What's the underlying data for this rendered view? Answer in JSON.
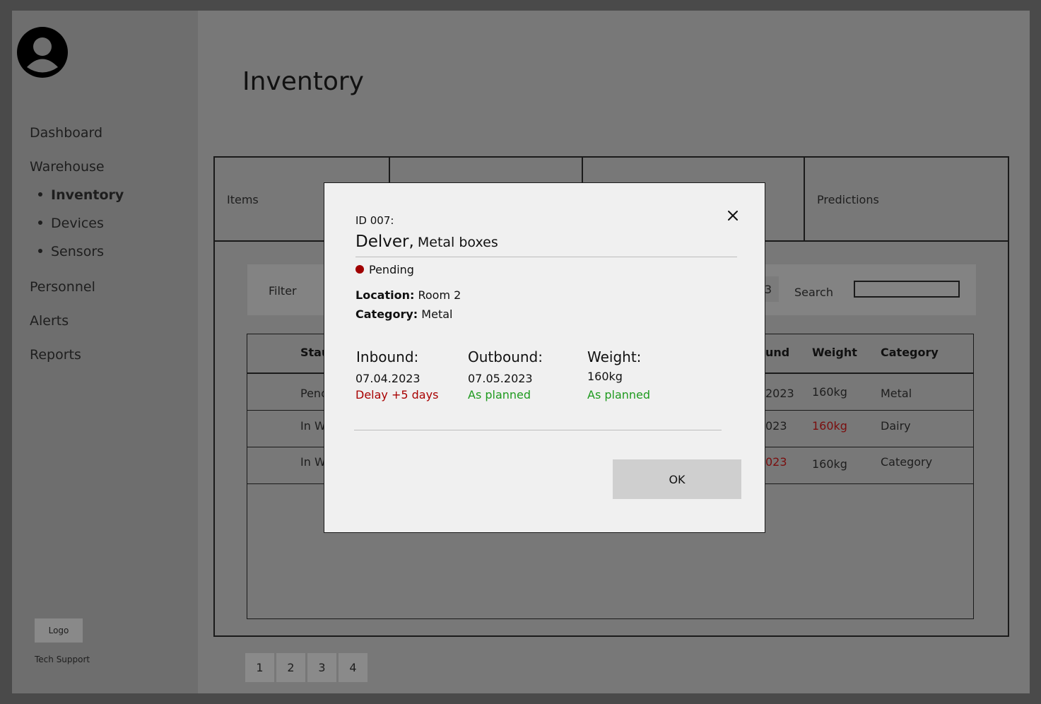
{
  "sidebar": {
    "avatar_icon": "user-avatar-icon",
    "nav": {
      "dashboard": "Dashboard",
      "warehouse": "Warehouse",
      "inventory": "Inventory",
      "devices": "Devices",
      "sensors": "Sensors",
      "personnel": "Personnel",
      "alerts": "Alerts",
      "reports": "Reports"
    },
    "logo": "Logo",
    "tech_support": "Tech Support"
  },
  "page": {
    "title": "Inventory"
  },
  "tabs": {
    "items": "Items",
    "predictions": "Predictions"
  },
  "filterbar": {
    "filter_label": "Filter",
    "chip_fragment": "3",
    "search_label": "Search",
    "search_value": ""
  },
  "table": {
    "headers": {
      "status_fragment": "Stau",
      "outbound_fragment": "und",
      "weight": "Weight",
      "category": "Category"
    },
    "rows": [
      {
        "status": "Penc",
        "date": "2023",
        "weight": "160kg",
        "category": "Metal"
      },
      {
        "status": "In W",
        "date": "023",
        "weight": "160kg",
        "category": "Dairy"
      },
      {
        "status": "In W",
        "date": "023",
        "weight": "160kg",
        "category": "Category"
      }
    ]
  },
  "pagination": [
    "1",
    "2",
    "3",
    "4"
  ],
  "modal": {
    "id": "ID 007:",
    "title": "Delver,",
    "subtitle": "Metal boxes",
    "status": "Pending",
    "location_label": "Location:",
    "location_value": "Room 2",
    "category_label": "Category:",
    "category_value": "Metal",
    "inbound": {
      "label": "Inbound:",
      "date": "07.04.2023",
      "status": "Delay +5 days"
    },
    "outbound": {
      "label": "Outbound:",
      "date": "07.05.2023",
      "status": "As planned"
    },
    "weight": {
      "label": "Weight:",
      "value": "160kg",
      "status": "As planned"
    },
    "ok": "OK",
    "close_icon": "close-icon"
  },
  "colors": {
    "status_red": "#a80000",
    "status_green": "#1f9a1f",
    "overlay": "#787878"
  }
}
